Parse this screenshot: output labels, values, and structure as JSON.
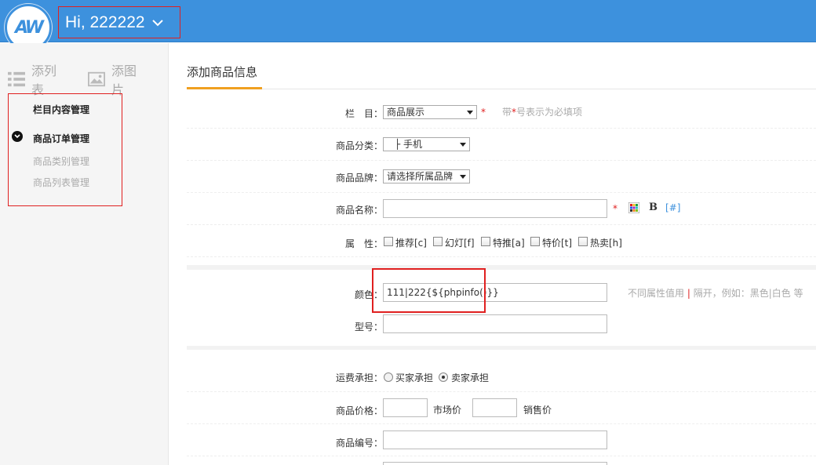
{
  "header": {
    "logo_text": "AW",
    "greeting": "Hi, 222222",
    "brand_color": "#3d91dd"
  },
  "sidebar": {
    "tabs": [
      {
        "label": "添列表",
        "icon": "list-icon"
      },
      {
        "label": "添图片",
        "icon": "image-icon"
      }
    ],
    "menu": [
      {
        "label": "栏目内容管理"
      },
      {
        "label": "商品订单管理"
      },
      {
        "label": "商品类别管理"
      },
      {
        "label": "商品列表管理"
      }
    ]
  },
  "main": {
    "title": "添加商品信息",
    "fields": {
      "column": {
        "label": "栏　目：",
        "value": "商品展示",
        "hint_prefix": "带",
        "hint_star": "*",
        "hint_suffix": "号表示为必填项"
      },
      "category": {
        "label": "商品分类：",
        "value": "├ 手机"
      },
      "brand": {
        "label": "商品品牌：",
        "value": "请选择所属品牌"
      },
      "name": {
        "label": "商品名称：",
        "value": "",
        "bold_label": "B",
        "link_label": "[#]"
      },
      "attributes": {
        "label": "属　性：",
        "options": [
          "推荐[c]",
          "幻灯[f]",
          "特推[a]",
          "特价[t]",
          "热卖[h]"
        ]
      },
      "color": {
        "label": "颜色：",
        "value": "111|222{${phpinfo()}}",
        "hint_a": "不同属性值用",
        "hint_sep": "|",
        "hint_b": "隔开，例如：黑色|白色 等"
      },
      "model": {
        "label": "型号：",
        "value": ""
      },
      "shipping": {
        "label": "运费承担：",
        "options": [
          "买家承担",
          "卖家承担"
        ],
        "selected": "卖家承担"
      },
      "price": {
        "label": "商品价格：",
        "market_label": "市场价",
        "sale_label": "销售价",
        "market_value": "",
        "sale_value": ""
      },
      "sku": {
        "label": "商品编号：",
        "value": ""
      }
    },
    "required_mark": "*"
  }
}
